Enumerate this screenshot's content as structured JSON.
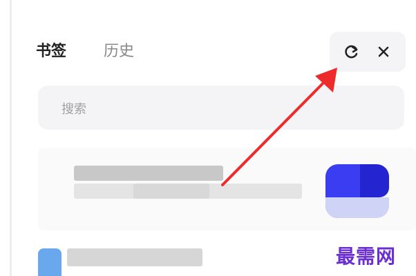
{
  "tabs": {
    "bookmarks_label": "书签",
    "history_label": "历史",
    "active": "bookmarks"
  },
  "toolbar": {
    "sync_icon": "sync-icon",
    "close_icon": "close-icon"
  },
  "search": {
    "placeholder": "搜索",
    "value": ""
  },
  "bookmark_items": [
    {
      "title": "",
      "url": "",
      "icon": "site-favicon-blue"
    },
    {
      "title": "",
      "url": "",
      "icon": "site-favicon-lightblue"
    }
  ],
  "annotation": {
    "arrow_color": "#ee2a2a"
  },
  "watermark": {
    "text": "最需网"
  },
  "colors": {
    "accent": "#3b3df2",
    "watermark": "#6b2ecf"
  }
}
